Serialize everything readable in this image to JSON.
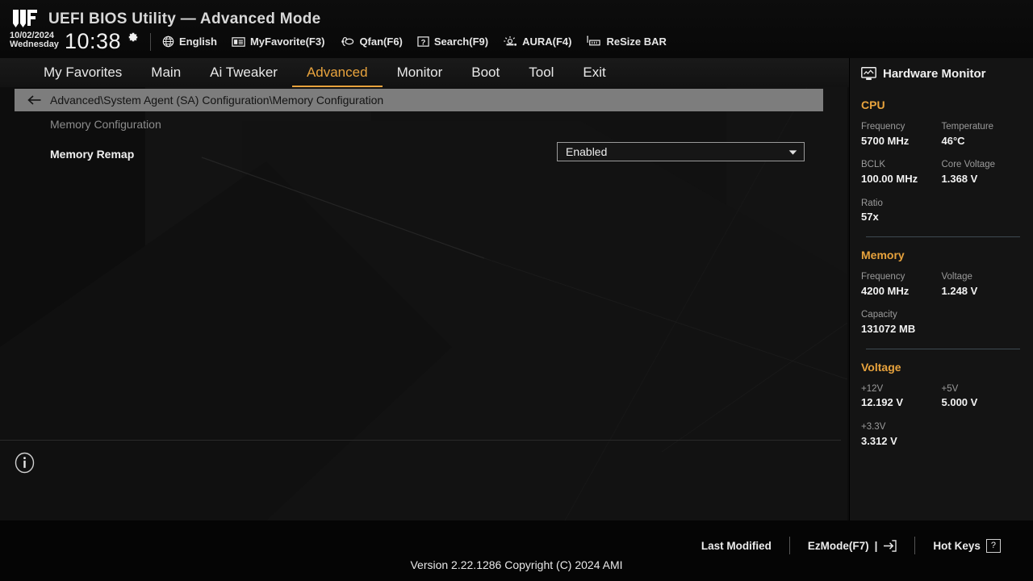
{
  "header": {
    "logo_icon": "tuf-gaming-logo",
    "title": "UEFI BIOS Utility — Advanced Mode",
    "date": "10/02/2024",
    "weekday": "Wednesday",
    "time": "10:38",
    "gear_icon": "gear-icon",
    "tools": [
      {
        "icon": "globe-icon",
        "label": "English"
      },
      {
        "icon": "myfavorite-icon",
        "label": "MyFavorite(F3)"
      },
      {
        "icon": "qfan-icon",
        "label": "Qfan(F6)"
      },
      {
        "icon": "search-icon",
        "label": "Search(F9)"
      },
      {
        "icon": "aura-icon",
        "label": "AURA(F4)"
      },
      {
        "icon": "resize-bar-icon",
        "label": "ReSize BAR"
      }
    ]
  },
  "nav": {
    "tabs": [
      {
        "label": "My Favorites",
        "active": false
      },
      {
        "label": "Main",
        "active": false
      },
      {
        "label": "Ai Tweaker",
        "active": false
      },
      {
        "label": "Advanced",
        "active": true
      },
      {
        "label": "Monitor",
        "active": false
      },
      {
        "label": "Boot",
        "active": false
      },
      {
        "label": "Tool",
        "active": false
      },
      {
        "label": "Exit",
        "active": false
      }
    ],
    "active_color": "#e8a33d"
  },
  "breadcrumb": {
    "back_icon": "back-arrow-icon",
    "path": "Advanced\\System Agent (SA) Configuration\\Memory Configuration"
  },
  "settings": {
    "section_label": "Memory Configuration",
    "option_label": "Memory Remap",
    "option_value": "Enabled",
    "caret_icon": "chevron-down-icon",
    "info_icon": "info-icon"
  },
  "hardware_monitor": {
    "icon": "monitor-icon",
    "title": "Hardware Monitor",
    "groups": [
      {
        "title": "CPU",
        "rows": [
          [
            {
              "key": "Frequency",
              "value": "5700 MHz"
            },
            {
              "key": "Temperature",
              "value": "46°C"
            }
          ],
          [
            {
              "key": "BCLK",
              "value": "100.00 MHz"
            },
            {
              "key": "Core Voltage",
              "value": "1.368 V"
            }
          ],
          [
            {
              "key": "Ratio",
              "value": "57x"
            }
          ]
        ]
      },
      {
        "title": "Memory",
        "rows": [
          [
            {
              "key": "Frequency",
              "value": "4200 MHz"
            },
            {
              "key": "Voltage",
              "value": "1.248 V"
            }
          ],
          [
            {
              "key": "Capacity",
              "value": "131072 MB"
            }
          ]
        ]
      },
      {
        "title": "Voltage",
        "rows": [
          [
            {
              "key": "+12V",
              "value": "12.192 V"
            },
            {
              "key": "+5V",
              "value": "5.000 V"
            }
          ],
          [
            {
              "key": "+3.3V",
              "value": "3.312 V"
            }
          ]
        ]
      }
    ]
  },
  "footer": {
    "last_modified": "Last Modified",
    "ezmode": "EzMode(F7)",
    "ezmode_suffix": "|",
    "ezmode_icon": "exit-arrow-icon",
    "hotkeys": "Hot Keys",
    "hotkeys_key": "?",
    "version": "Version 2.22.1286 Copyright (C) 2024 AMI"
  }
}
